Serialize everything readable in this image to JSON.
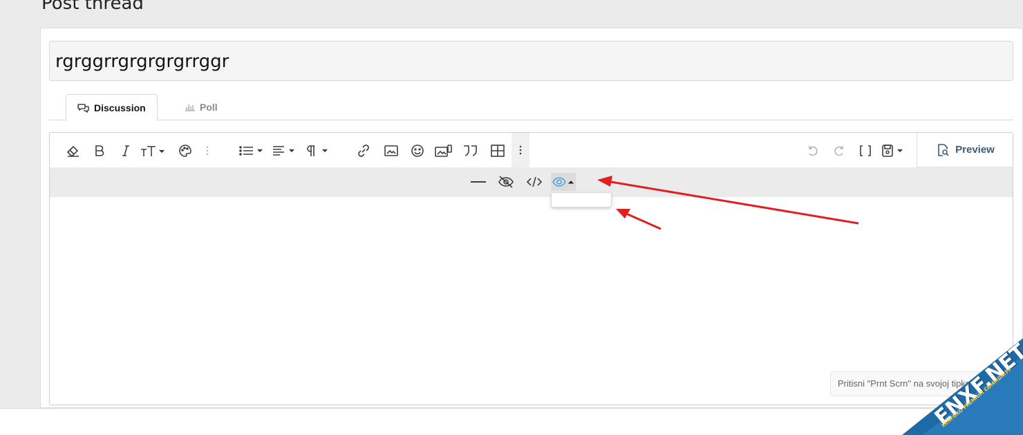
{
  "page": {
    "title": "Post thread"
  },
  "thread": {
    "title_value": "rgrggrrgrgrgrgrrggr"
  },
  "tabs": [
    {
      "label": "Discussion",
      "icon": "chat-bubbles-icon",
      "active": true
    },
    {
      "label": "Poll",
      "icon": "bar-chart-icon",
      "active": false
    }
  ],
  "toolbar": {
    "left_buttons": [
      "eraser-icon",
      "bold-icon",
      "italic-icon",
      "font-size-icon",
      "palette-icon",
      "vertical-dots-icon",
      "list-icon",
      "align-icon",
      "paragraph-icon",
      "link-icon",
      "image-icon",
      "smiley-icon",
      "media-icon",
      "quote-icon",
      "table-icon",
      "more-icon"
    ],
    "right_buttons": [
      "undo-icon",
      "redo-icon",
      "brackets-icon",
      "drafts-icon"
    ],
    "preview_label": "Preview"
  },
  "subtoolbar": {
    "buttons": [
      "horizontal-rule-icon",
      "hide-icon",
      "code-icon",
      "eye-dropdown-icon"
    ]
  },
  "hint": {
    "text": "Pritisni \"Prnt Scrn\" na svojoj tipkovnici da"
  },
  "watermark": {
    "text": "ENXF.NET",
    "subtext": "XENFORO PREMIUM COMMUNITY"
  },
  "colors": {
    "accent": "#4aa0d8",
    "arrow": "#e02020",
    "preview_text": "#3d5a74"
  }
}
